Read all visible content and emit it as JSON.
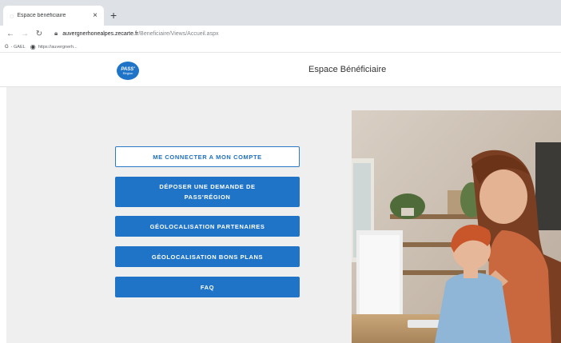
{
  "browser": {
    "tab_title": "Espace bénéficiaire",
    "tab_close": "×",
    "new_tab": "+",
    "url_host": "auvergnerhonealpes.zecarte.fr",
    "url_path": "/Beneficiaire/Views/Accueil.aspx",
    "bookmarks": [
      {
        "label": "- GAEL"
      },
      {
        "label": "https://auvergnerh..."
      }
    ]
  },
  "header": {
    "logo_line1": "PASS'",
    "logo_line2": "Région",
    "title": "Espace Bénéficiaire"
  },
  "menu": {
    "login_label": "ME CONNECTER A MON COMPTE",
    "request_label": "DÉPOSER UNE DEMANDE DE PASS'RÉGION",
    "partners_label": "GÉOLOCALISATION PARTENAIRES",
    "deals_label": "GÉOLOCALISATION BONS PLANS",
    "faq_label": "FAQ"
  },
  "colors": {
    "accent": "#1f74c8",
    "page_background": "#efefef",
    "browser_chrome": "#dee1e6"
  }
}
